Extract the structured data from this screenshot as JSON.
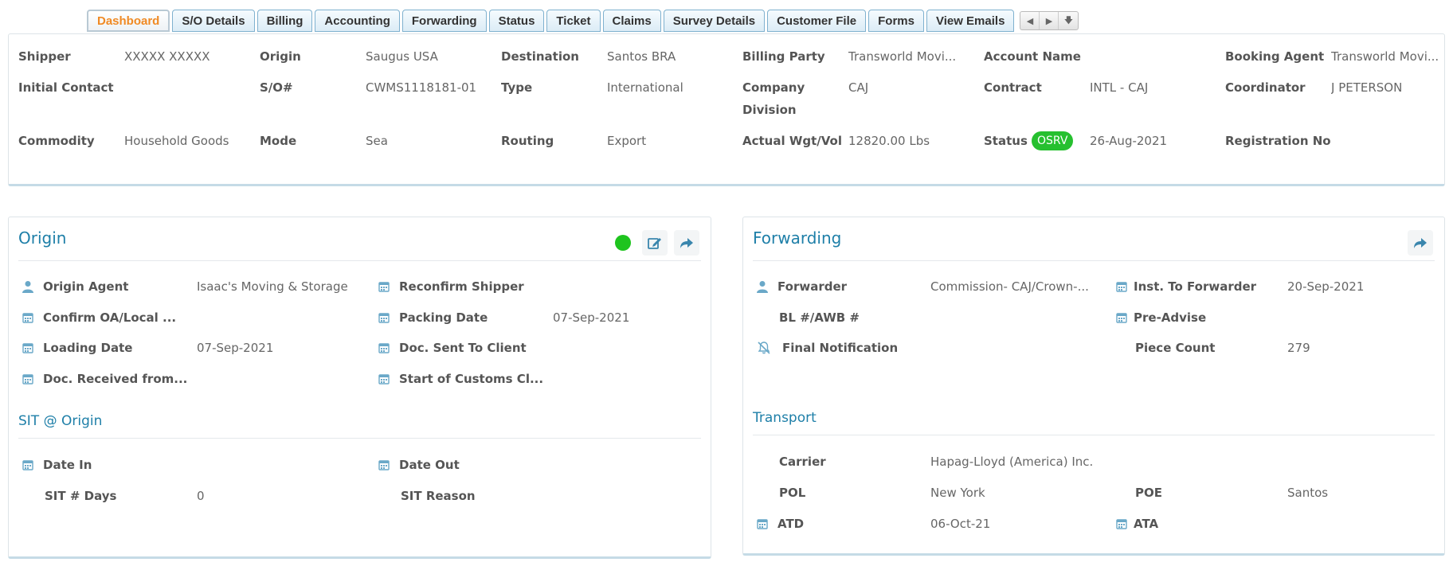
{
  "tabs": [
    "Dashboard",
    "S/O Details",
    "Billing",
    "Accounting",
    "Forwarding",
    "Status",
    "Ticket",
    "Claims",
    "Survey Details",
    "Customer File",
    "Forms",
    "View Emails"
  ],
  "summary": {
    "shipper_label": "Shipper",
    "shipper": "XXXXX XXXXX",
    "origin_label": "Origin",
    "origin": "Saugus USA",
    "destination_label": "Destination",
    "destination": "Santos BRA",
    "billing_party_label": "Billing Party",
    "billing_party": "Transworld Movi...",
    "account_name_label": "Account Name",
    "account_name": "",
    "booking_agent_label": "Booking Agent",
    "booking_agent": "Transworld Movi...",
    "initial_contact_label": "Initial Contact",
    "initial_contact": "",
    "so_label": "S/O#",
    "so": "CWMS1118181-01",
    "type_label": "Type",
    "type": "International",
    "company_division_label_1": "Company",
    "company_division_label_2": "Division",
    "company_division": "CAJ",
    "contract_label": "Contract",
    "contract": "INTL - CAJ",
    "coordinator_label": "Coordinator",
    "coordinator": "J PETERSON",
    "commodity_label": "Commodity",
    "commodity": "Household Goods",
    "mode_label": "Mode",
    "mode": "Sea",
    "routing_label": "Routing",
    "routing": "Export",
    "actual_wgt_label": "Actual Wgt/Vol",
    "actual_wgt": "12820.00 Lbs",
    "status_label": "Status",
    "status_badge": "OSRV",
    "status_date": "26-Aug-2021",
    "registration_label": "Registration No",
    "registration": ""
  },
  "origin_card": {
    "title": "Origin",
    "origin_agent_label": "Origin Agent",
    "origin_agent": "Isaac's Moving & Storage",
    "reconfirm_shipper_label": "Reconfirm Shipper",
    "reconfirm_shipper": "",
    "confirm_oa_label": "Confirm OA/Local ...",
    "confirm_oa": "",
    "packing_date_label": "Packing Date",
    "packing_date": "07-Sep-2021",
    "loading_date_label": "Loading Date",
    "loading_date": "07-Sep-2021",
    "doc_sent_label": "Doc. Sent To Client",
    "doc_sent": "",
    "doc_received_label": "Doc. Received from...",
    "doc_received": "",
    "customs_label": "Start of Customs Cl...",
    "customs": "",
    "sit_title": "SIT @ Origin",
    "date_in_label": "Date In",
    "date_in": "",
    "date_out_label": "Date Out",
    "date_out": "",
    "sit_days_label": "SIT # Days",
    "sit_days": "0",
    "sit_reason_label": "SIT Reason",
    "sit_reason": ""
  },
  "forwarding_card": {
    "title": "Forwarding",
    "forwarder_label": "Forwarder",
    "forwarder": "Commission- CAJ/Crown-...",
    "inst_label": "Inst. To Forwarder",
    "inst": "20-Sep-2021",
    "bl_label": "BL #/AWB #",
    "bl": "",
    "pre_advise_label": "Pre-Advise",
    "pre_advise": "",
    "final_notification_label": "Final Notification",
    "piece_count_label": "Piece Count",
    "piece_count": "279",
    "transport_title": "Transport",
    "carrier_label": "Carrier",
    "carrier": "Hapag-Lloyd (America) Inc.",
    "pol_label": "POL",
    "pol": "New York",
    "poe_label": "POE",
    "poe": "Santos",
    "atd_label": "ATD",
    "atd": "06-Oct-21",
    "ata_label": "ATA",
    "ata": ""
  },
  "colors": {
    "accent": "#1e7fa8",
    "active_tab": "#f08a24",
    "status_green": "#26c02f"
  }
}
